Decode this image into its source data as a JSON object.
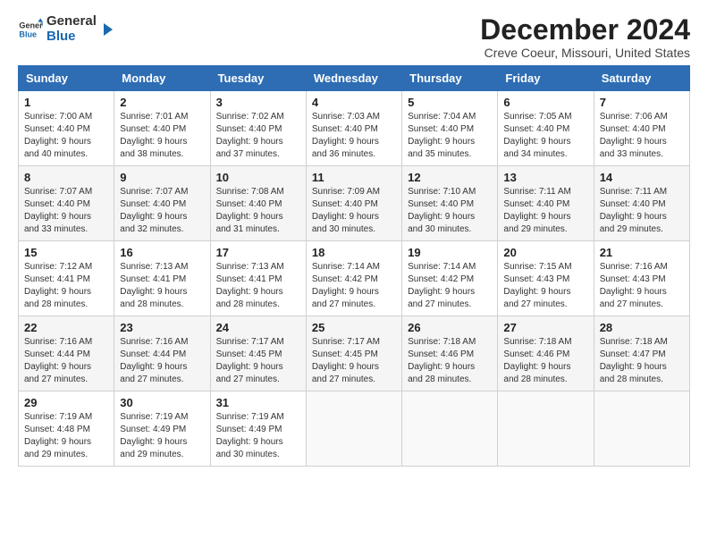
{
  "logo": {
    "text_general": "General",
    "text_blue": "Blue"
  },
  "header": {
    "title": "December 2024",
    "subtitle": "Creve Coeur, Missouri, United States"
  },
  "calendar": {
    "columns": [
      "Sunday",
      "Monday",
      "Tuesday",
      "Wednesday",
      "Thursday",
      "Friday",
      "Saturday"
    ],
    "weeks": [
      [
        {
          "day": "1",
          "sunrise": "Sunrise: 7:00 AM",
          "sunset": "Sunset: 4:40 PM",
          "daylight": "Daylight: 9 hours and 40 minutes."
        },
        {
          "day": "2",
          "sunrise": "Sunrise: 7:01 AM",
          "sunset": "Sunset: 4:40 PM",
          "daylight": "Daylight: 9 hours and 38 minutes."
        },
        {
          "day": "3",
          "sunrise": "Sunrise: 7:02 AM",
          "sunset": "Sunset: 4:40 PM",
          "daylight": "Daylight: 9 hours and 37 minutes."
        },
        {
          "day": "4",
          "sunrise": "Sunrise: 7:03 AM",
          "sunset": "Sunset: 4:40 PM",
          "daylight": "Daylight: 9 hours and 36 minutes."
        },
        {
          "day": "5",
          "sunrise": "Sunrise: 7:04 AM",
          "sunset": "Sunset: 4:40 PM",
          "daylight": "Daylight: 9 hours and 35 minutes."
        },
        {
          "day": "6",
          "sunrise": "Sunrise: 7:05 AM",
          "sunset": "Sunset: 4:40 PM",
          "daylight": "Daylight: 9 hours and 34 minutes."
        },
        {
          "day": "7",
          "sunrise": "Sunrise: 7:06 AM",
          "sunset": "Sunset: 4:40 PM",
          "daylight": "Daylight: 9 hours and 33 minutes."
        }
      ],
      [
        {
          "day": "8",
          "sunrise": "Sunrise: 7:07 AM",
          "sunset": "Sunset: 4:40 PM",
          "daylight": "Daylight: 9 hours and 33 minutes."
        },
        {
          "day": "9",
          "sunrise": "Sunrise: 7:07 AM",
          "sunset": "Sunset: 4:40 PM",
          "daylight": "Daylight: 9 hours and 32 minutes."
        },
        {
          "day": "10",
          "sunrise": "Sunrise: 7:08 AM",
          "sunset": "Sunset: 4:40 PM",
          "daylight": "Daylight: 9 hours and 31 minutes."
        },
        {
          "day": "11",
          "sunrise": "Sunrise: 7:09 AM",
          "sunset": "Sunset: 4:40 PM",
          "daylight": "Daylight: 9 hours and 30 minutes."
        },
        {
          "day": "12",
          "sunrise": "Sunrise: 7:10 AM",
          "sunset": "Sunset: 4:40 PM",
          "daylight": "Daylight: 9 hours and 30 minutes."
        },
        {
          "day": "13",
          "sunrise": "Sunrise: 7:11 AM",
          "sunset": "Sunset: 4:40 PM",
          "daylight": "Daylight: 9 hours and 29 minutes."
        },
        {
          "day": "14",
          "sunrise": "Sunrise: 7:11 AM",
          "sunset": "Sunset: 4:40 PM",
          "daylight": "Daylight: 9 hours and 29 minutes."
        }
      ],
      [
        {
          "day": "15",
          "sunrise": "Sunrise: 7:12 AM",
          "sunset": "Sunset: 4:41 PM",
          "daylight": "Daylight: 9 hours and 28 minutes."
        },
        {
          "day": "16",
          "sunrise": "Sunrise: 7:13 AM",
          "sunset": "Sunset: 4:41 PM",
          "daylight": "Daylight: 9 hours and 28 minutes."
        },
        {
          "day": "17",
          "sunrise": "Sunrise: 7:13 AM",
          "sunset": "Sunset: 4:41 PM",
          "daylight": "Daylight: 9 hours and 28 minutes."
        },
        {
          "day": "18",
          "sunrise": "Sunrise: 7:14 AM",
          "sunset": "Sunset: 4:42 PM",
          "daylight": "Daylight: 9 hours and 27 minutes."
        },
        {
          "day": "19",
          "sunrise": "Sunrise: 7:14 AM",
          "sunset": "Sunset: 4:42 PM",
          "daylight": "Daylight: 9 hours and 27 minutes."
        },
        {
          "day": "20",
          "sunrise": "Sunrise: 7:15 AM",
          "sunset": "Sunset: 4:43 PM",
          "daylight": "Daylight: 9 hours and 27 minutes."
        },
        {
          "day": "21",
          "sunrise": "Sunrise: 7:16 AM",
          "sunset": "Sunset: 4:43 PM",
          "daylight": "Daylight: 9 hours and 27 minutes."
        }
      ],
      [
        {
          "day": "22",
          "sunrise": "Sunrise: 7:16 AM",
          "sunset": "Sunset: 4:44 PM",
          "daylight": "Daylight: 9 hours and 27 minutes."
        },
        {
          "day": "23",
          "sunrise": "Sunrise: 7:16 AM",
          "sunset": "Sunset: 4:44 PM",
          "daylight": "Daylight: 9 hours and 27 minutes."
        },
        {
          "day": "24",
          "sunrise": "Sunrise: 7:17 AM",
          "sunset": "Sunset: 4:45 PM",
          "daylight": "Daylight: 9 hours and 27 minutes."
        },
        {
          "day": "25",
          "sunrise": "Sunrise: 7:17 AM",
          "sunset": "Sunset: 4:45 PM",
          "daylight": "Daylight: 9 hours and 27 minutes."
        },
        {
          "day": "26",
          "sunrise": "Sunrise: 7:18 AM",
          "sunset": "Sunset: 4:46 PM",
          "daylight": "Daylight: 9 hours and 28 minutes."
        },
        {
          "day": "27",
          "sunrise": "Sunrise: 7:18 AM",
          "sunset": "Sunset: 4:46 PM",
          "daylight": "Daylight: 9 hours and 28 minutes."
        },
        {
          "day": "28",
          "sunrise": "Sunrise: 7:18 AM",
          "sunset": "Sunset: 4:47 PM",
          "daylight": "Daylight: 9 hours and 28 minutes."
        }
      ],
      [
        {
          "day": "29",
          "sunrise": "Sunrise: 7:19 AM",
          "sunset": "Sunset: 4:48 PM",
          "daylight": "Daylight: 9 hours and 29 minutes."
        },
        {
          "day": "30",
          "sunrise": "Sunrise: 7:19 AM",
          "sunset": "Sunset: 4:49 PM",
          "daylight": "Daylight: 9 hours and 29 minutes."
        },
        {
          "day": "31",
          "sunrise": "Sunrise: 7:19 AM",
          "sunset": "Sunset: 4:49 PM",
          "daylight": "Daylight: 9 hours and 30 minutes."
        },
        null,
        null,
        null,
        null
      ]
    ]
  }
}
